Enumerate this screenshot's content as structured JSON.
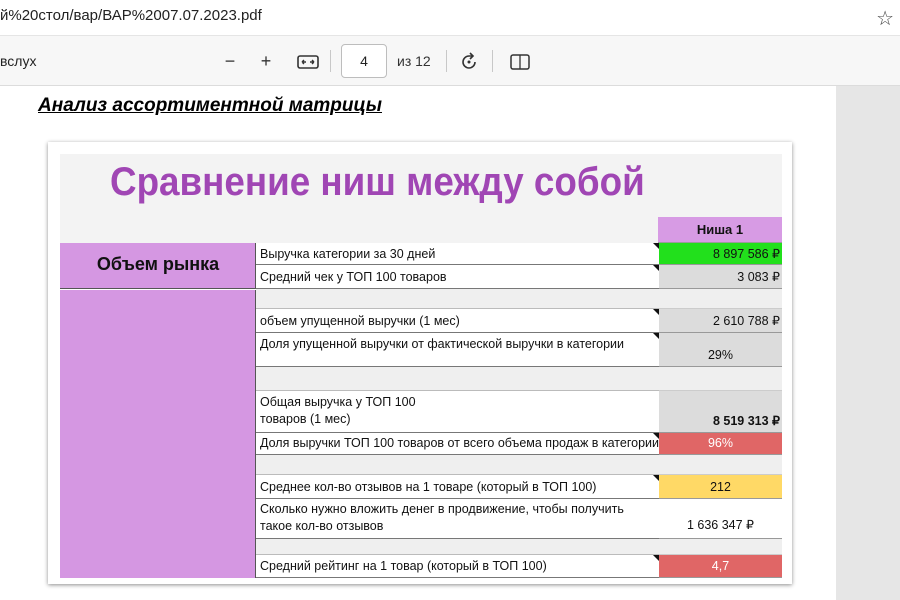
{
  "browser": {
    "url": "й%20стол/вар/ВАР%2007.07.2023.pdf",
    "favorite_icon": "star-outline-icon"
  },
  "pdf_toolbar": {
    "read_aloud_label": "вслух",
    "zoom_out_icon": "minus-icon",
    "zoom_in_icon": "plus-icon",
    "fit_icon": "fit-width-icon",
    "current_page": "4",
    "page_count_label": "из 12",
    "rotate_icon": "rotate-icon",
    "page_view_icon": "page-view-icon"
  },
  "document": {
    "heading": "Анализ ассортиментной матрицы",
    "sheet": {
      "title": "Сравнение ниш между собой",
      "column_header": "Ниша 1",
      "section_label": "Объем рынка",
      "rows": [
        {
          "label": "Выручка категории за 30 дней",
          "value": "8 897 586 ₽",
          "bg": "#22e01c"
        },
        {
          "label": "Средний чек у ТОП 100 товаров",
          "value": "3 083 ₽",
          "bg": "#dcdcdc"
        },
        {
          "label": "",
          "value": "",
          "bg": ""
        },
        {
          "label": "объем упущенной выручки (1 мес)",
          "value": "2 610 788 ₽",
          "bg": "#dcdcdc"
        },
        {
          "label": "Доля упущенной выручки от фактической выручки в категории",
          "value": "29%",
          "bg": "#dcdcdc"
        },
        {
          "label": "",
          "value": "",
          "bg": ""
        },
        {
          "label": "Общая выручка у ТОП 100 товаров (1 мес)",
          "value": "8 519 313 ₽",
          "bg": "#dcdcdc"
        },
        {
          "label": "Доля выручки ТОП 100 товаров от всего объема продаж в категории",
          "value": "96%",
          "bg": "#e06666"
        },
        {
          "label": "",
          "value": "",
          "bg": ""
        },
        {
          "label": "Среднее кол-во отзывов на 1 товаре (который в ТОП 100)",
          "value": "212",
          "bg": "#ffd966"
        },
        {
          "label": "Сколько нужно вложить денег в продвижение, чтобы получить такое кол-во отзывов",
          "value": "1 636 347 ₽",
          "bg": "#ffffff"
        },
        {
          "label": "",
          "value": "",
          "bg": ""
        },
        {
          "label": "Средний рейтинг на 1 товар (который в ТОП 100)",
          "value": "4,7",
          "bg": "#e06666"
        }
      ]
    }
  }
}
